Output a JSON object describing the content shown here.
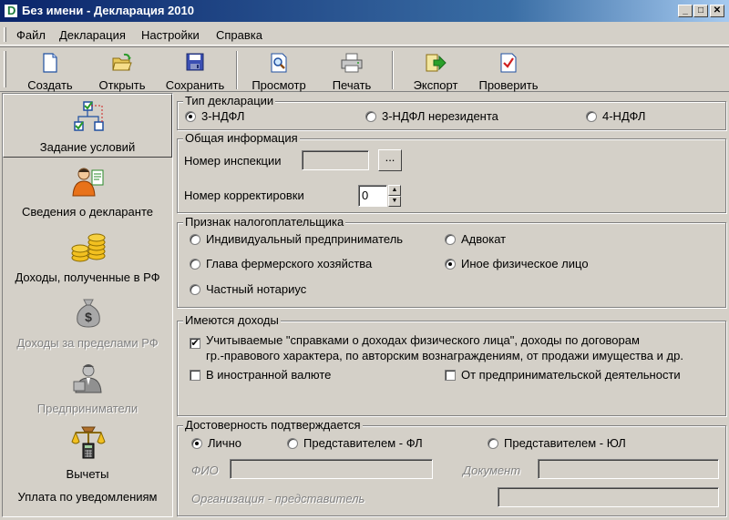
{
  "window": {
    "title": "Без имени - Декларация 2010",
    "min_glyph": "_",
    "max_glyph": "□",
    "close_glyph": "✕"
  },
  "menu": {
    "items": [
      "Файл",
      "Декларация",
      "Настройки",
      "Справка"
    ]
  },
  "toolbar": {
    "create": "Создать",
    "open": "Открыть",
    "save": "Сохранить",
    "preview": "Просмотр",
    "print": "Печать",
    "export": "Экспорт",
    "check": "Проверить"
  },
  "nav": {
    "items": [
      {
        "label": "Задание условий",
        "state": "selected"
      },
      {
        "label": "Сведения о декларанте",
        "state": "enabled"
      },
      {
        "label": "Доходы, полученные в РФ",
        "state": "enabled"
      },
      {
        "label": "Доходы за пределами РФ",
        "state": "disabled"
      },
      {
        "label": "Предприниматели",
        "state": "disabled"
      },
      {
        "label": "Вычеты",
        "state": "enabled"
      },
      {
        "label": "Уплата по уведомлениям",
        "state": "enabled"
      }
    ]
  },
  "decl_type": {
    "title": "Тип декларации",
    "options": [
      "3-НДФЛ",
      "3-НДФЛ нерезидента",
      "4-НДФЛ"
    ],
    "selected": "3-НДФЛ"
  },
  "general": {
    "title": "Общая информация",
    "inspection_label": "Номер инспекции",
    "inspection_value": "",
    "browse_label": "...",
    "correction_label": "Номер корректировки",
    "correction_value": "0"
  },
  "taxpayer": {
    "title": "Признак налогоплательщика",
    "options": [
      "Индивидуальный предприниматель",
      "Адвокат",
      "Глава фермерского хозяйства",
      "Иное физическое лицо",
      "Частный нотариус"
    ],
    "selected": "Иное физическое лицо"
  },
  "income": {
    "title": "Имеются доходы",
    "cert_line1": "Учитываемые \"справками о доходах физического лица\", доходы по договорам",
    "cert_line2": "гр.-правового характера, по авторским вознаграждениям, от продажи имущества и др.",
    "cert_checked": true,
    "foreign": "В иностранной валюте",
    "foreign_checked": false,
    "business": "От предпринимательской деятельности",
    "business_checked": false
  },
  "confirm": {
    "title": "Достоверность подтверждается",
    "options": [
      "Лично",
      "Представителем - ФЛ",
      "Представителем - ЮЛ"
    ],
    "selected": "Лично",
    "fio_label": "ФИО",
    "doc_label": "Документ",
    "org_label": "Организация - представитель"
  },
  "colors": {
    "title_start": "#0a246a",
    "title_end": "#a6caf0",
    "face": "#d4d0c8"
  }
}
